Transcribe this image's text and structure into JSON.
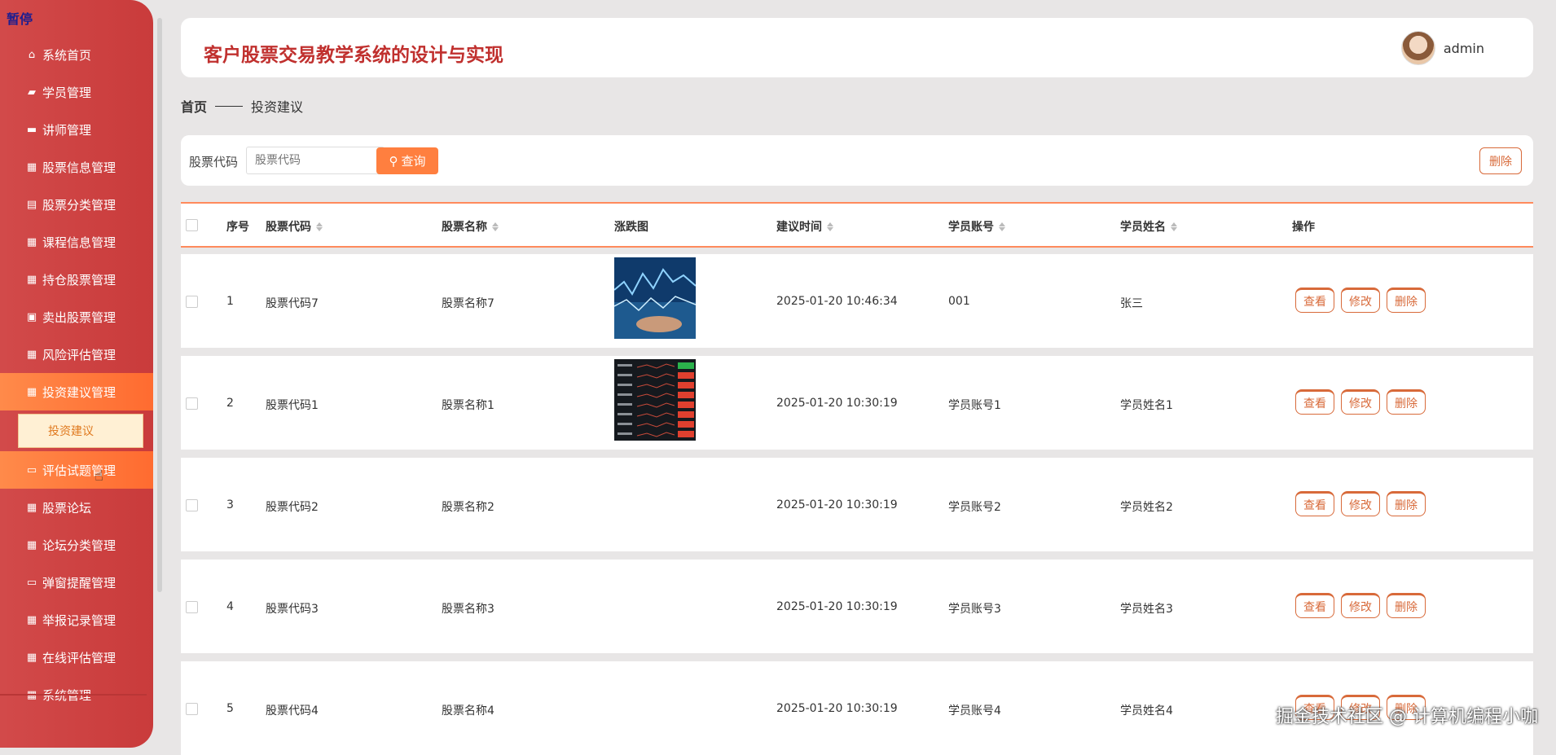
{
  "sidebar": {
    "pause_label": "暂停",
    "items": [
      {
        "label": "系统首页",
        "icon": "home-icon",
        "glyph": "⌂"
      },
      {
        "label": "学员管理",
        "icon": "user-card-icon",
        "glyph": "▰"
      },
      {
        "label": "讲师管理",
        "icon": "briefcase-icon",
        "glyph": "▬"
      },
      {
        "label": "股票信息管理",
        "icon": "grid-icon",
        "glyph": "▦"
      },
      {
        "label": "股票分类管理",
        "icon": "chart-icon",
        "glyph": "▤"
      },
      {
        "label": "课程信息管理",
        "icon": "grid-icon",
        "glyph": "▦"
      },
      {
        "label": "持仓股票管理",
        "icon": "grid-icon",
        "glyph": "▦"
      },
      {
        "label": "卖出股票管理",
        "icon": "clipboard-icon",
        "glyph": "▣"
      },
      {
        "label": "风险评估管理",
        "icon": "grid-icon",
        "glyph": "▦"
      },
      {
        "label": "投资建议管理",
        "icon": "grid-icon",
        "glyph": "▦"
      },
      {
        "label": "评估试题管理",
        "icon": "comment-icon",
        "glyph": "▭"
      },
      {
        "label": "股票论坛",
        "icon": "grid-icon",
        "glyph": "▦"
      },
      {
        "label": "论坛分类管理",
        "icon": "table-icon",
        "glyph": "▦"
      },
      {
        "label": "弹窗提醒管理",
        "icon": "monitor-icon",
        "glyph": "▭"
      },
      {
        "label": "举报记录管理",
        "icon": "grid-icon",
        "glyph": "▦"
      },
      {
        "label": "在线评估管理",
        "icon": "grid-icon",
        "glyph": "▦"
      },
      {
        "label": "系统管理",
        "icon": "grid-icon",
        "glyph": "▦"
      }
    ],
    "active_sub": "投资建议"
  },
  "header": {
    "title": "客户股票交易教学系统的设计与实现",
    "username": "admin"
  },
  "breadcrumb": {
    "home": "首页",
    "current": "投资建议"
  },
  "search": {
    "label": "股票代码",
    "placeholder": "股票代码",
    "button": "查询",
    "delete_button": "删除"
  },
  "table": {
    "headers": [
      "序号",
      "股票代码",
      "股票名称",
      "涨跌图",
      "建议时间",
      "学员账号",
      "学员姓名",
      "操作"
    ],
    "rows": [
      {
        "no": "1",
        "code": "股票代码7",
        "name": "股票名称7",
        "chart": "blue",
        "time": "2025-01-20 10:46:34",
        "account": "001",
        "student": "张三"
      },
      {
        "no": "2",
        "code": "股票代码1",
        "name": "股票名称1",
        "chart": "dark",
        "time": "2025-01-20 10:30:19",
        "account": "学员账号1",
        "student": "学员姓名1"
      },
      {
        "no": "3",
        "code": "股票代码2",
        "name": "股票名称2",
        "chart": "",
        "time": "2025-01-20 10:30:19",
        "account": "学员账号2",
        "student": "学员姓名2"
      },
      {
        "no": "4",
        "code": "股票代码3",
        "name": "股票名称3",
        "chart": "",
        "time": "2025-01-20 10:30:19",
        "account": "学员账号3",
        "student": "学员姓名3"
      },
      {
        "no": "5",
        "code": "股票代码4",
        "name": "股票名称4",
        "chart": "",
        "time": "2025-01-20 10:30:19",
        "account": "学员账号4",
        "student": "学员姓名4"
      }
    ],
    "ops": [
      "查看",
      "修改",
      "删除"
    ]
  },
  "watermark": "掘金技术社区 @ 计算机编程小咖",
  "colors": {
    "sidebar": "#cf4242",
    "accent": "#ff7f3f",
    "title": "#c0302e"
  }
}
